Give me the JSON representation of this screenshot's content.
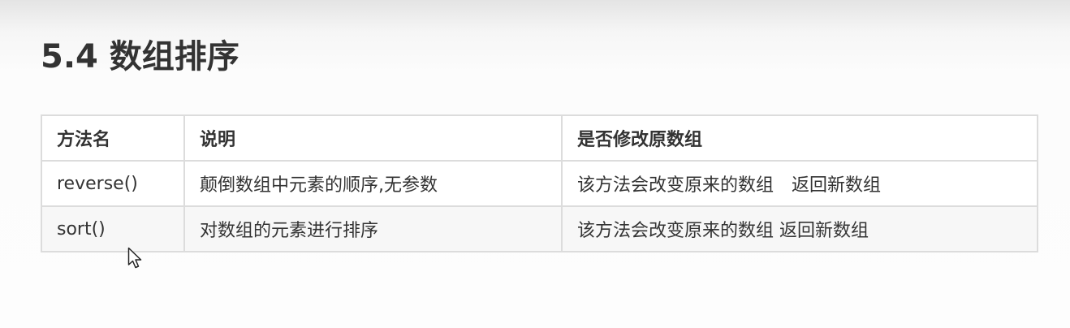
{
  "heading": "5.4 数组排序",
  "table": {
    "headers": {
      "name": "方法名",
      "description": "说明",
      "modifies": "是否修改原数组"
    },
    "rows": [
      {
        "name": "reverse()",
        "description": "颠倒数组中元素的顺序,无参数",
        "modifies": "该方法会改变原来的数组　返回新数组"
      },
      {
        "name": "sort()",
        "description": "对数组的元素进行排序",
        "modifies": "该方法会改变原来的数组 返回新数组"
      }
    ]
  },
  "icons": {
    "cursor": "mouse-pointer-icon"
  },
  "colors": {
    "text": "#333333",
    "border": "#dcdcdc",
    "row_alt_background": "#f7f7f7"
  }
}
